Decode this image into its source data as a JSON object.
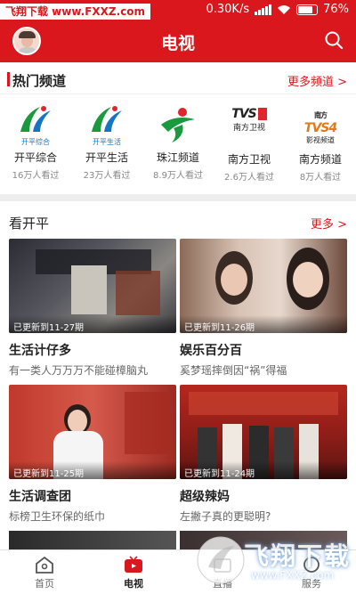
{
  "status_bar": {
    "watermark": "飞翔下载 www.FXXZ.com",
    "speed": "0.30K/s",
    "battery": "76%"
  },
  "header": {
    "title": "电视"
  },
  "hot_channels": {
    "title": "热门频道",
    "more": "更多频道 >",
    "items": [
      {
        "name": "开平综合",
        "views": "16万人看过",
        "logo_text": "开平综合"
      },
      {
        "name": "开平生活",
        "views": "23万人看过",
        "logo_text": "开平生活"
      },
      {
        "name": "珠江频道",
        "views": "8.9万人看过",
        "logo_text": ""
      },
      {
        "name": "南方卫视",
        "views": "2.6万人看过",
        "logo_text": "南方卫视"
      },
      {
        "name": "南方频道",
        "views": "8万人看过",
        "logo_text": "影视频道"
      }
    ]
  },
  "kaiping": {
    "title": "看开平",
    "more": "更多 >",
    "videos": [
      {
        "title": "生活计仔多",
        "subtitle": "有一类人万万万不能碰樟脑丸",
        "badge": "已更新到11-27期"
      },
      {
        "title": "娱乐百分百",
        "subtitle": "奚梦瑶摔倒因“祸”得福",
        "badge": "已更新到11-26期"
      },
      {
        "title": "生活调查团",
        "subtitle": "标榜卫生环保的纸巾",
        "badge": "已更新到11-25期"
      },
      {
        "title": "超级辣妈",
        "subtitle": "左撇子真的更聪明?",
        "badge": "已更新到11-24期"
      }
    ]
  },
  "tabbar": {
    "items": [
      {
        "label": "首页",
        "icon": "home-icon"
      },
      {
        "label": "电视",
        "icon": "tv-icon"
      },
      {
        "label": "直播",
        "icon": "live-icon"
      },
      {
        "label": "服务",
        "icon": "service-icon"
      }
    ]
  },
  "bottom_watermark": {
    "main": "飞翔下载",
    "url": "www.FXXZ.com"
  },
  "colors": {
    "brand_red": "#d9171d",
    "text_dark": "#222222",
    "text_gray": "#888888"
  }
}
